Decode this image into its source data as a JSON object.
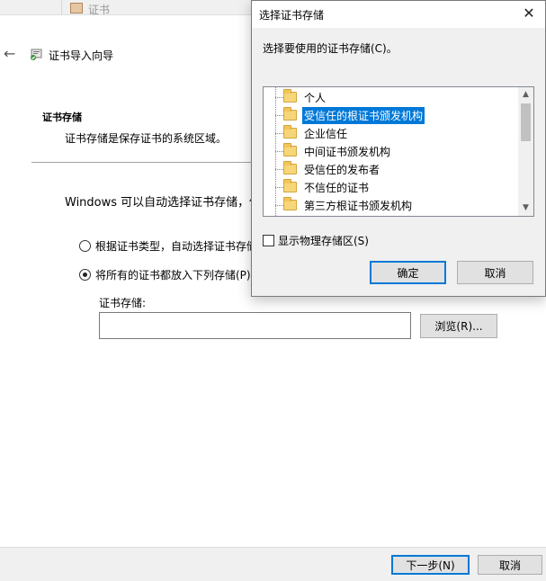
{
  "background_window": {
    "tab_title": "证书"
  },
  "wizard": {
    "title": "证书导入向导",
    "section_heading": "证书存储",
    "section_description": "证书存储是保存证书的系统区域。",
    "intro_text": "Windows 可以自动选择证书存储，你也",
    "options": [
      {
        "label": "根据证书类型，自动选择证书存储",
        "checked": false
      },
      {
        "label": "将所有的证书都放入下列存储(P)",
        "checked": true
      }
    ],
    "store_label": "证书存储:",
    "store_value": "",
    "browse_label": "浏览(R)...",
    "next_label": "下一步(N)",
    "cancel_label": "取消"
  },
  "dialog": {
    "title": "选择证书存储",
    "close_glyph": "✕",
    "prompt": "选择要使用的证书存储(C)。",
    "stores": [
      {
        "label": "个人",
        "selected": false
      },
      {
        "label": "受信任的根证书颁发机构",
        "selected": true
      },
      {
        "label": "企业信任",
        "selected": false
      },
      {
        "label": "中间证书颁发机构",
        "selected": false
      },
      {
        "label": "受信任的发布者",
        "selected": false
      },
      {
        "label": "不信任的证书",
        "selected": false
      },
      {
        "label": "第三方根证书颁发机构",
        "selected": false
      }
    ],
    "show_physical_label": "显示物理存储区(S)",
    "show_physical_checked": false,
    "ok_label": "确定",
    "cancel_label": "取消"
  },
  "colors": {
    "accent": "#0078d7",
    "selection": "#0078d7",
    "folder": "#f7d67a"
  }
}
